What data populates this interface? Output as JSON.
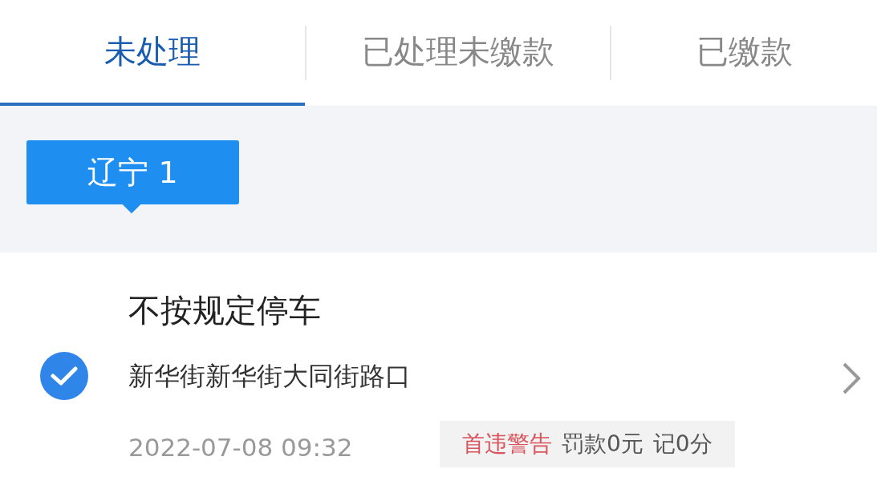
{
  "tabs": [
    {
      "label": "未处理",
      "selected": true
    },
    {
      "label": "已处理未缴款",
      "selected": false
    },
    {
      "label": "已缴款",
      "selected": false
    }
  ],
  "plate": {
    "label": "辽宁 1"
  },
  "violation": {
    "checked": true,
    "title": "不按规定停车",
    "address": "新华街新华街大同街路口",
    "time": "2022-07-08 09:32",
    "warning": "首违警告",
    "fine": "罚款0元",
    "points": "记0分"
  }
}
